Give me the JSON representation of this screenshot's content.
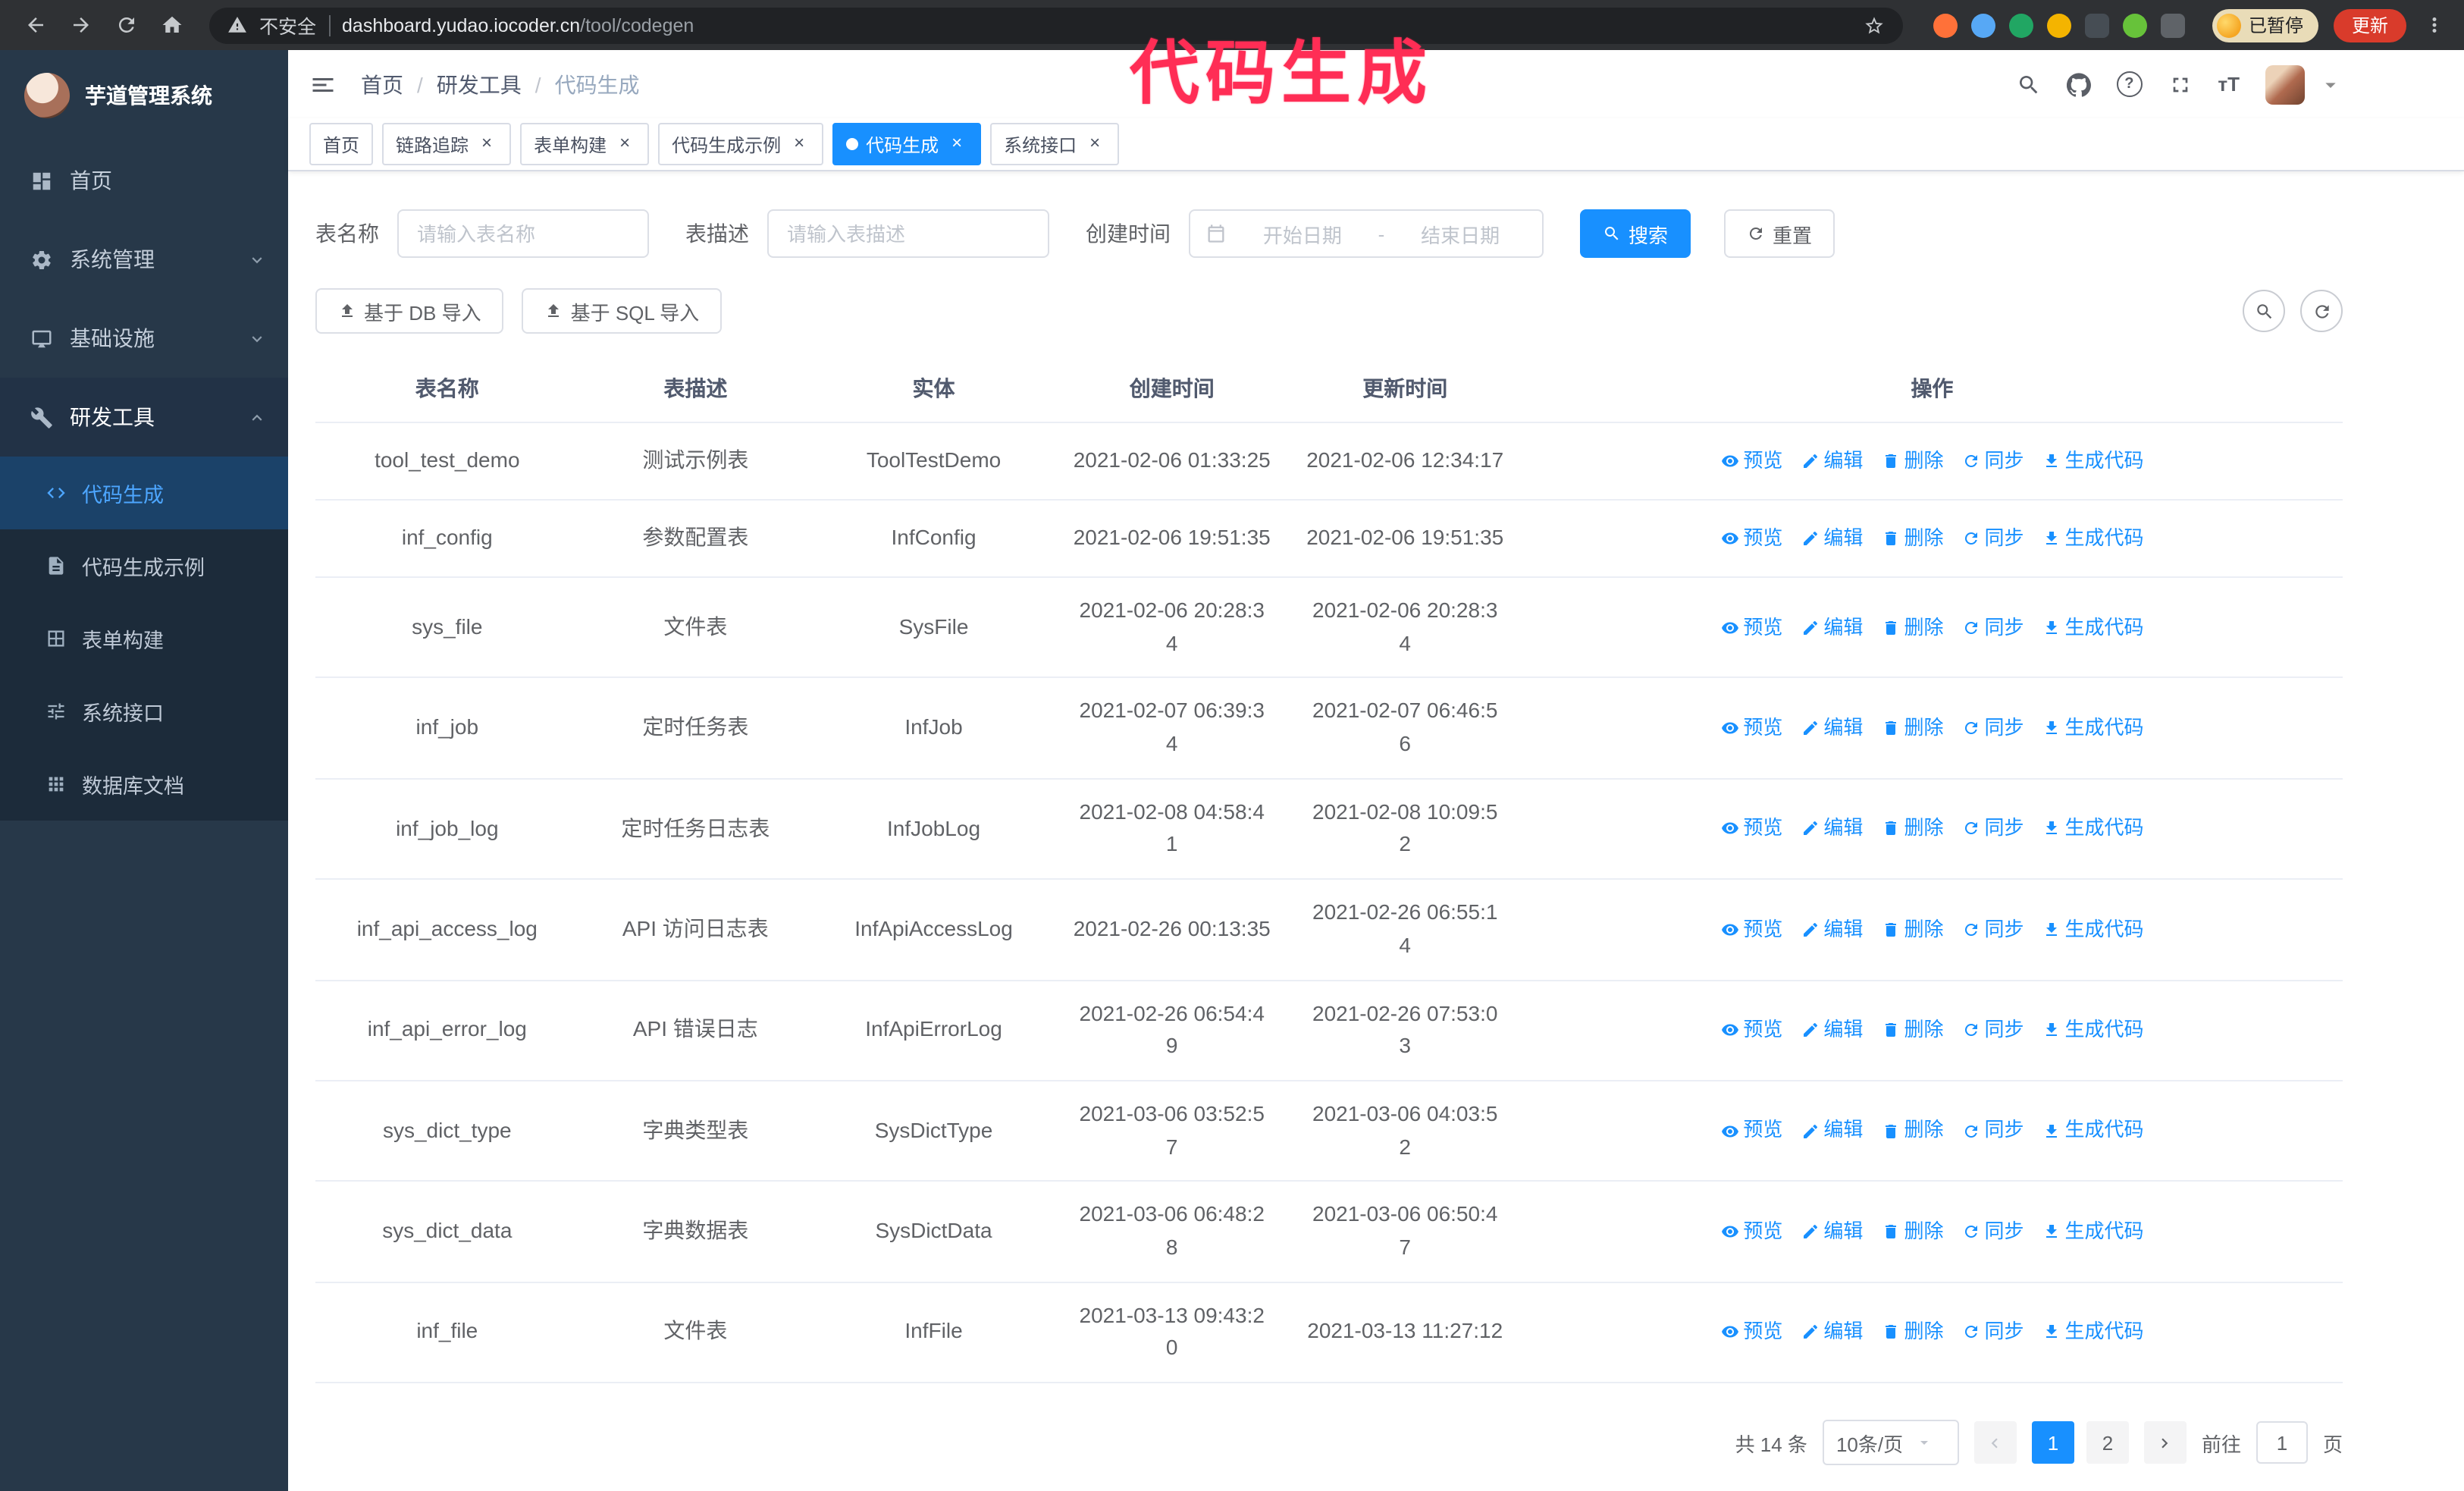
{
  "colors": {
    "accent": "#1890ff"
  },
  "annotation": {
    "text": "代码生成",
    "color": "#ff2d55"
  },
  "browser": {
    "security_warning": "不安全",
    "url_domain": "dashboard.yudao.iocoder.cn",
    "url_path": "/tool/codegen",
    "paused_badge": "已暂停",
    "update_button": "更新",
    "extensions": [
      {
        "name": "fox-extension-icon",
        "color": "#ff7139"
      },
      {
        "name": "drop-extension-icon",
        "color": "#57a8f5"
      },
      {
        "name": "check-extension-icon",
        "color": "#21a663"
      },
      {
        "name": "people-extension-icon",
        "color": "#f4b400"
      },
      {
        "name": "monitor-extension-icon",
        "color": "#464d54"
      },
      {
        "name": "leaf-extension-icon",
        "color": "#67c23a"
      },
      {
        "name": "puzzle-extension-icon",
        "color": "#5f6368"
      }
    ]
  },
  "sidebar": {
    "app_title": "芋道管理系统",
    "items": [
      {
        "label": "首页",
        "icon": "home-icon"
      },
      {
        "label": "系统管理",
        "icon": "gear-icon",
        "chevron": "down"
      },
      {
        "label": "基础设施",
        "icon": "infra-icon",
        "chevron": "down"
      },
      {
        "label": "研发工具",
        "icon": "tools-icon",
        "chevron": "up",
        "expanded": true
      }
    ],
    "submenu": [
      {
        "label": "代码生成",
        "icon": "code-icon",
        "active": true
      },
      {
        "label": "代码生成示例",
        "icon": "example-icon"
      },
      {
        "label": "表单构建",
        "icon": "form-icon"
      },
      {
        "label": "系统接口",
        "icon": "api-icon"
      },
      {
        "label": "数据库文档",
        "icon": "database-icon"
      }
    ]
  },
  "header": {
    "breadcrumb": [
      "首页",
      "研发工具",
      "代码生成"
    ]
  },
  "tabs": [
    {
      "label": "首页"
    },
    {
      "label": "链路追踪",
      "closable": true
    },
    {
      "label": "表单构建",
      "closable": true
    },
    {
      "label": "代码生成示例",
      "closable": true
    },
    {
      "label": "代码生成",
      "closable": true,
      "active": true
    },
    {
      "label": "系统接口",
      "closable": true
    }
  ],
  "filters": {
    "table_name_label": "表名称",
    "table_name_placeholder": "请输入表名称",
    "table_desc_label": "表描述",
    "table_desc_placeholder": "请输入表描述",
    "create_time_label": "创建时间",
    "date_start_placeholder": "开始日期",
    "date_separator": "-",
    "date_end_placeholder": "结束日期",
    "search_button": "搜索",
    "reset_button": "重置"
  },
  "toolbar": {
    "import_db_button": "基于 DB 导入",
    "import_sql_button": "基于 SQL 导入"
  },
  "table": {
    "columns": [
      "表名称",
      "表描述",
      "实体",
      "创建时间",
      "更新时间",
      "操作"
    ],
    "row_actions": [
      {
        "label": "预览",
        "icon": "eye-icon",
        "name": "preview-link"
      },
      {
        "label": "编辑",
        "icon": "edit-icon",
        "name": "edit-link"
      },
      {
        "label": "删除",
        "icon": "delete-icon",
        "name": "delete-link"
      },
      {
        "label": "同步",
        "icon": "sync-icon",
        "name": "sync-link"
      },
      {
        "label": "生成代码",
        "icon": "generate-icon",
        "name": "generate-code-link"
      }
    ],
    "rows": [
      {
        "name": "tool_test_demo",
        "description": "测试示例表",
        "entity": "ToolTestDemo",
        "create_time": "2021-02-06 01:33:25",
        "update_time": "2021-02-06 12:34:17"
      },
      {
        "name": "inf_config",
        "description": "参数配置表",
        "entity": "InfConfig",
        "create_time": "2021-02-06 19:51:35",
        "update_time": "2021-02-06 19:51:35"
      },
      {
        "name": "sys_file",
        "description": "文件表",
        "entity": "SysFile",
        "create_time": "2021-02-06 20:28:3\n4",
        "update_time": "2021-02-06 20:28:3\n4"
      },
      {
        "name": "inf_job",
        "description": "定时任务表",
        "entity": "InfJob",
        "create_time": "2021-02-07 06:39:3\n4",
        "update_time": "2021-02-07 06:46:5\n6"
      },
      {
        "name": "inf_job_log",
        "description": "定时任务日志表",
        "entity": "InfJobLog",
        "create_time": "2021-02-08 04:58:4\n1",
        "update_time": "2021-02-08 10:09:5\n2"
      },
      {
        "name": "inf_api_access_log",
        "description": "API 访问日志表",
        "entity": "InfApiAccessLog",
        "create_time": "2021-02-26 00:13:35",
        "update_time": "2021-02-26 06:55:1\n4"
      },
      {
        "name": "inf_api_error_log",
        "description": "API 错误日志",
        "entity": "InfApiErrorLog",
        "create_time": "2021-02-26 06:54:4\n9",
        "update_time": "2021-02-26 07:53:0\n3"
      },
      {
        "name": "sys_dict_type",
        "description": "字典类型表",
        "entity": "SysDictType",
        "create_time": "2021-03-06 03:52:5\n7",
        "update_time": "2021-03-06 04:03:5\n2"
      },
      {
        "name": "sys_dict_data",
        "description": "字典数据表",
        "entity": "SysDictData",
        "create_time": "2021-03-06 06:48:2\n8",
        "update_time": "2021-03-06 06:50:4\n7"
      },
      {
        "name": "inf_file",
        "description": "文件表",
        "entity": "InfFile",
        "create_time": "2021-03-13 09:43:2\n0",
        "update_time": "2021-03-13 11:27:12"
      }
    ]
  },
  "pagination": {
    "total_text": "共 14 条",
    "page_size": "10条/页",
    "pages": [
      "1",
      "2"
    ],
    "active_page": "1",
    "goto_label": "前往",
    "goto_value": "1",
    "goto_suffix": "页"
  }
}
